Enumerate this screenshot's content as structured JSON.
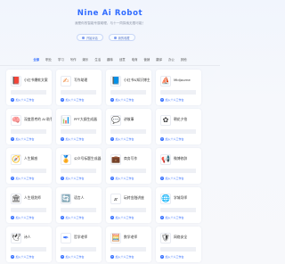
{
  "hero": {
    "title": "Nine Ai Robot",
    "subtitle": "我是你的智能专属助理，与十一同探索无限可能！",
    "actions": [
      "开始对话",
      "我的收藏"
    ]
  },
  "tabs": [
    "全部",
    "职业",
    "学习",
    "写作",
    "娱乐",
    "生活",
    "趣味",
    "创意",
    "电商",
    "营销",
    "翻译",
    "办公",
    "其他"
  ],
  "active_tab_index": 0,
  "add_label": "加入个人工作台",
  "cards": [
    {
      "title": "小红书爆款文案",
      "icon": "notebook-icon",
      "glyph": "📕",
      "color": "#e6534b"
    },
    {
      "title": "写作助理",
      "icon": "pen-icon",
      "glyph": "✍",
      "color": "#f0873a"
    },
    {
      "title": "小红书&知识博主",
      "icon": "book-icon",
      "glyph": "📘",
      "color": "#444"
    },
    {
      "title": "Midjourne",
      "icon": "sailboat-icon",
      "glyph": "⛵",
      "color": "#444"
    },
    {
      "title": "深度思考的 AI 助手",
      "icon": "brain-icon",
      "glyph": "🧠",
      "color": "#2f6bff"
    },
    {
      "title": "PPT大纲生成器",
      "icon": "presentation-icon",
      "glyph": "📊",
      "color": "#e6534b"
    },
    {
      "title": "讲故事",
      "icon": "chat-icon",
      "glyph": "💬",
      "color": "#e6534b"
    },
    {
      "title": "朝花夕拾",
      "icon": "flower-icon",
      "glyph": "✿",
      "color": "#444"
    },
    {
      "title": "人生解惑",
      "icon": "compass-icon",
      "glyph": "🧭",
      "color": "#2f6bff"
    },
    {
      "title": "公众号标题生成器",
      "icon": "badge-icon",
      "glyph": "🏅",
      "color": "#f0b43a"
    },
    {
      "title": "商务写作",
      "icon": "briefcase-icon",
      "glyph": "💼",
      "color": "#e6534b"
    },
    {
      "title": "微博修辞",
      "icon": "megaphone-icon",
      "glyph": "📢",
      "color": "#444"
    },
    {
      "title": "人生规划师",
      "icon": "pillar-icon",
      "glyph": "🏛",
      "color": "#444"
    },
    {
      "title": "语言人",
      "icon": "refresh-icon",
      "glyph": "🔄",
      "color": "#2fae5a"
    },
    {
      "title": "玩转金融讲座",
      "icon": "chart-icon",
      "glyph": "𝓍",
      "color": "#444"
    },
    {
      "title": "学城导师",
      "icon": "globe-icon",
      "glyph": "🌐",
      "color": "#2f6bff"
    },
    {
      "title": "诗人",
      "icon": "feather-icon",
      "glyph": "🕊",
      "color": "#444"
    },
    {
      "title": "哲学老师",
      "icon": "quill-icon",
      "glyph": "✒",
      "color": "#2f6bff"
    },
    {
      "title": "数学老师",
      "icon": "calculator-icon",
      "glyph": "🧮",
      "color": "#2fae5a"
    },
    {
      "title": "网络安全",
      "icon": "shield-icon",
      "glyph": "🛡",
      "color": "#444"
    }
  ]
}
